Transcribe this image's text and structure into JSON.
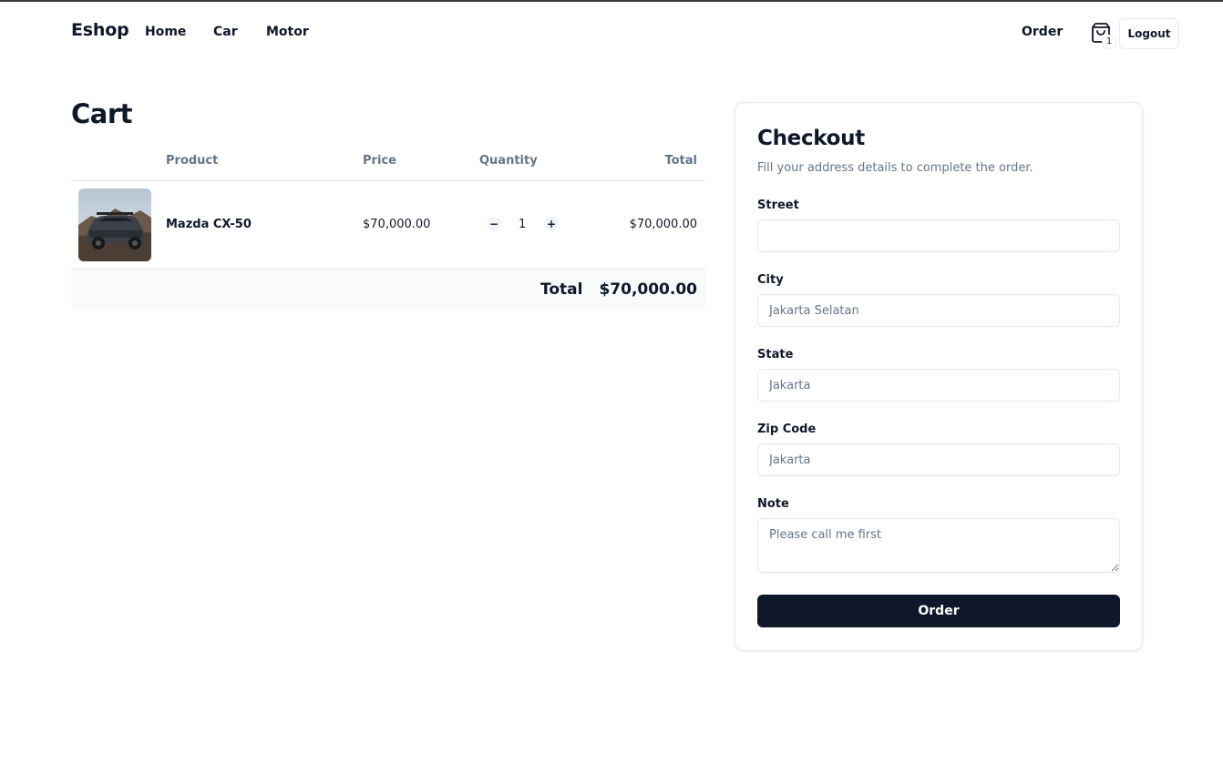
{
  "nav": {
    "brand": "Eshop",
    "links": [
      "Home",
      "Car",
      "Motor"
    ],
    "order": "Order",
    "cart_count": "1",
    "logout": "Logout"
  },
  "cart": {
    "title": "Cart",
    "columns": [
      "Product",
      "Price",
      "Quantity",
      "Total"
    ],
    "items": [
      {
        "name": "Mazda CX-50",
        "price": "$70,000.00",
        "quantity": "1",
        "total": "$70,000.00",
        "minus": "−",
        "plus": "+"
      }
    ],
    "total_label": "Total",
    "total_value": "$70,000.00"
  },
  "checkout": {
    "title": "Checkout",
    "subtitle": "Fill your address details to complete the order.",
    "street": {
      "label": "Street",
      "value": "",
      "placeholder": ""
    },
    "city": {
      "label": "City",
      "value": "",
      "placeholder": "Jakarta Selatan"
    },
    "state": {
      "label": "State",
      "value": "",
      "placeholder": "Jakarta"
    },
    "zip": {
      "label": "Zip Code",
      "value": "",
      "placeholder": "Jakarta"
    },
    "note": {
      "label": "Note",
      "value": "",
      "placeholder": "Please call me first"
    },
    "submit": "Order"
  },
  "colors": {
    "primary": "#0f172a",
    "muted": "#64748b",
    "border": "#e2e8f0",
    "footer_bg": "#f8fafc"
  }
}
